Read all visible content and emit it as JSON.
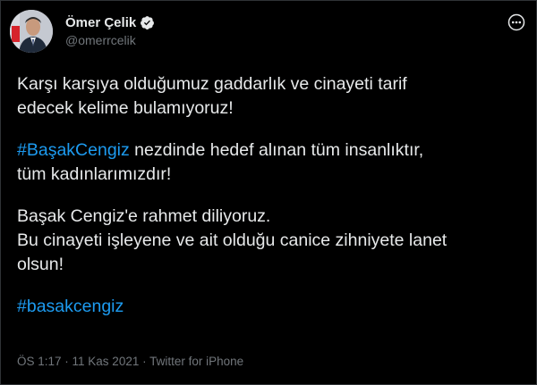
{
  "user": {
    "display_name": "Ömer Çelik",
    "handle": "@omerrcelik",
    "verified": true,
    "avatar_icon": "profile-photo"
  },
  "more_icon": "more-dots-icon",
  "tweet": {
    "line1": "Karşı karşıya olduğumuz gaddarlık ve cinayeti tarif",
    "line2": "edecek kelime bulamıyoruz!",
    "hashtag1": "#BaşakCengiz",
    "line3_rest": " nezdinde hedef alınan tüm insanlıktır,",
    "line4": "tüm kadınlarımızdır!",
    "line5": "Başak Cengiz'e rahmet diliyoruz.",
    "line6": "Bu cinayeti işleyene ve ait olduğu canice zihniyete lanet",
    "line7": "olsun!",
    "hashtag2": "#basakcengiz"
  },
  "meta": {
    "time": "ÖS 1:17",
    "date": "11 Kas 2021",
    "source": "Twitter for iPhone",
    "separator": " · "
  },
  "colors": {
    "background": "#000000",
    "text": "#e7e9ea",
    "secondary": "#71767b",
    "link": "#1d9bf0"
  }
}
